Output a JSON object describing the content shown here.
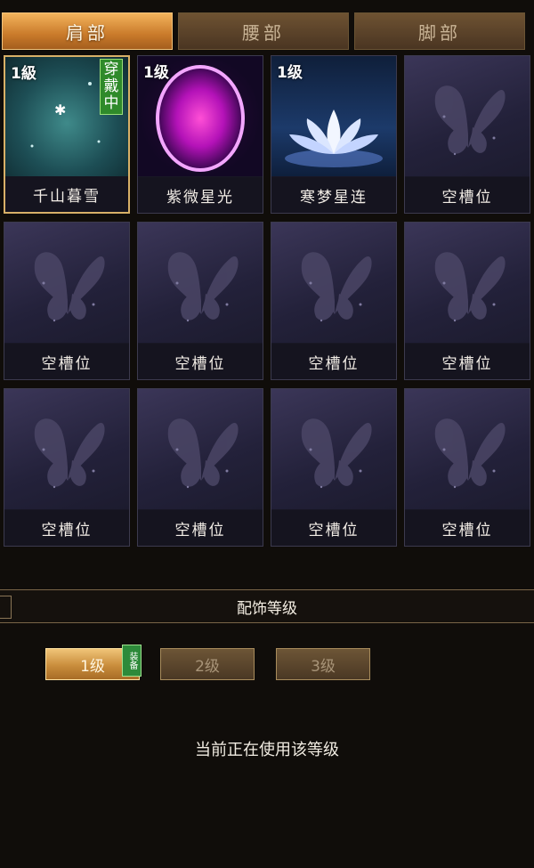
{
  "tabs": [
    "肩部",
    "腰部",
    "脚部"
  ],
  "active_tab": 0,
  "slots": [
    {
      "level": "1級",
      "name": "千山暮雪",
      "worn_label": "穿戴中",
      "art": "snow"
    },
    {
      "level": "1级",
      "name": "紫微星光",
      "art": "purple-orb"
    },
    {
      "level": "1级",
      "name": "寒梦星连",
      "art": "lotus"
    },
    {
      "name": "空槽位",
      "art": "empty"
    },
    {
      "name": "空槽位",
      "art": "empty"
    },
    {
      "name": "空槽位",
      "art": "empty"
    },
    {
      "name": "空槽位",
      "art": "empty"
    },
    {
      "name": "空槽位",
      "art": "empty"
    },
    {
      "name": "空槽位",
      "art": "empty"
    },
    {
      "name": "空槽位",
      "art": "empty"
    },
    {
      "name": "空槽位",
      "art": "empty"
    },
    {
      "name": "空槽位",
      "art": "empty"
    }
  ],
  "section_title": "配饰等级",
  "level_buttons": [
    "1级",
    "2级",
    "3级"
  ],
  "active_level": 0,
  "equip_tag": "装备",
  "status_text": "当前正在使用该等级",
  "colors": {
    "accent": "#c98d3c",
    "equip_green": "#2d8a3a"
  }
}
